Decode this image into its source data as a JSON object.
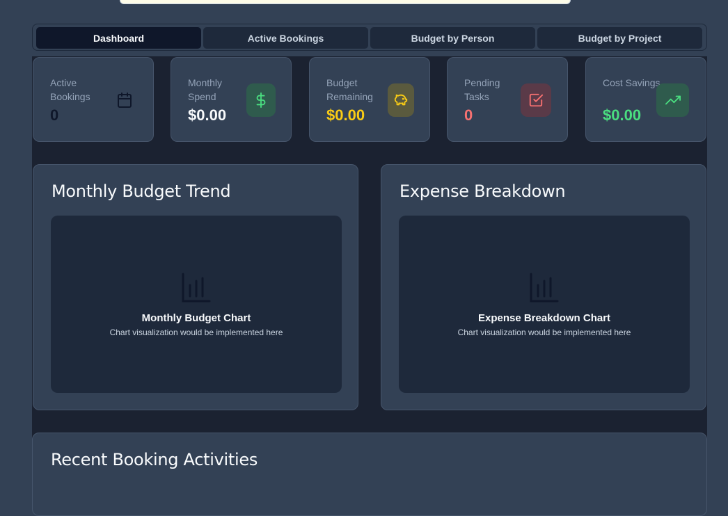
{
  "tabs": [
    {
      "label": "Dashboard",
      "active": true
    },
    {
      "label": "Active Bookings",
      "active": false
    },
    {
      "label": "Budget by Person",
      "active": false
    },
    {
      "label": "Budget by Project",
      "active": false
    }
  ],
  "stats": [
    {
      "label": "Active Bookings",
      "value": "0",
      "icon": "calendar-icon",
      "color": "#0f172a"
    },
    {
      "label": "Monthly Spend",
      "value": "$0.00",
      "icon": "dollar-icon",
      "color": "#f8fafc",
      "accent": "#4ade80"
    },
    {
      "label": "Budget Remaining",
      "value": "$0.00",
      "icon": "piggy-bank-icon",
      "color": "#facc15",
      "accent": "#facc15"
    },
    {
      "label": "Pending Tasks",
      "value": "0",
      "icon": "checkbox-icon",
      "color": "#f87171",
      "accent": "#f87171"
    },
    {
      "label": "Cost Savings",
      "value": "$0.00",
      "icon": "trending-up-icon",
      "color": "#4ade80",
      "accent": "#4ade80"
    }
  ],
  "panels": {
    "monthly": {
      "title": "Monthly Budget Trend",
      "placeholder_title": "Monthly Budget Chart",
      "placeholder_sub": "Chart visualization would be implemented here",
      "icon": "bar-chart-icon"
    },
    "expense": {
      "title": "Expense Breakdown",
      "placeholder_title": "Expense Breakdown Chart",
      "placeholder_sub": "Chart visualization would be implemented here",
      "icon": "bar-chart-icon"
    }
  },
  "recent": {
    "title": "Recent Booking Activities"
  }
}
